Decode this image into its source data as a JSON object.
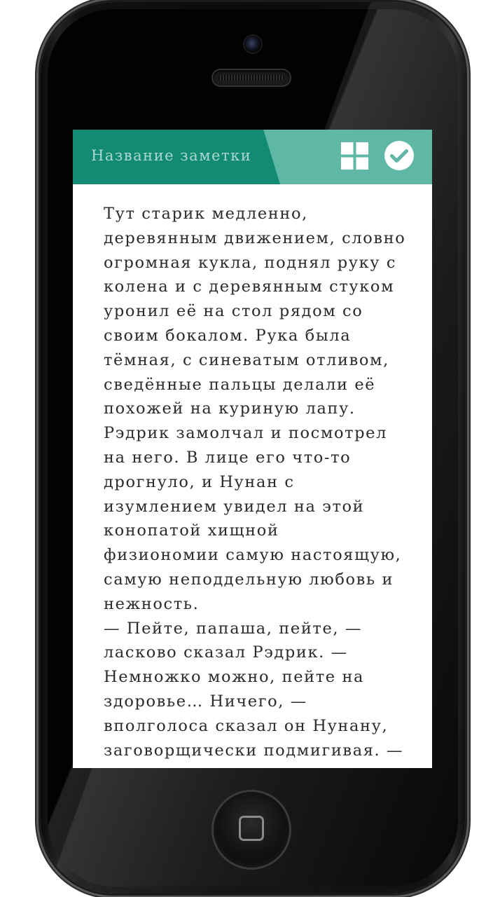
{
  "app_bar": {
    "title": "Название заметки",
    "background_color": "#138a73",
    "accent_color": "#5fb7a5",
    "actions": [
      {
        "icon": "grid-icon",
        "label": ""
      },
      {
        "icon": "check-circle-icon",
        "label": ""
      }
    ]
  },
  "note": {
    "text": "Тут старик медленно,\nдеревянным движением, словно\nогромная кукла, поднял руку с\nколена и с деревянным стуком\nуронил её на стол рядом со\nсвоим бокалом. Рука была\nтёмная, с синеватым отливом,\nсведённые пальцы делали её\nпохожей на куриную лапу.\nРэдрик замолчал и посмотрел\nна него. В лице его что-то\nдрогнуло, и Нунан с\nизумлением увидел на этой\nконопатой хищной\nфизиономии самую настоящую,\nсамую неподдельную любовь и\nнежность.\n— Пейте, папаша, пейте, —\nласково сказал Рэдрик. —\nНемножко можно, пейте на\nздоровье… Ничего, —\nвполголоса сказал он Нунану,\nзаговорщически подмигивая. —"
  },
  "device": {
    "home_button_icon": "home-square-icon",
    "camera_icon": "camera-icon",
    "speaker_icon": "speaker-icon"
  }
}
